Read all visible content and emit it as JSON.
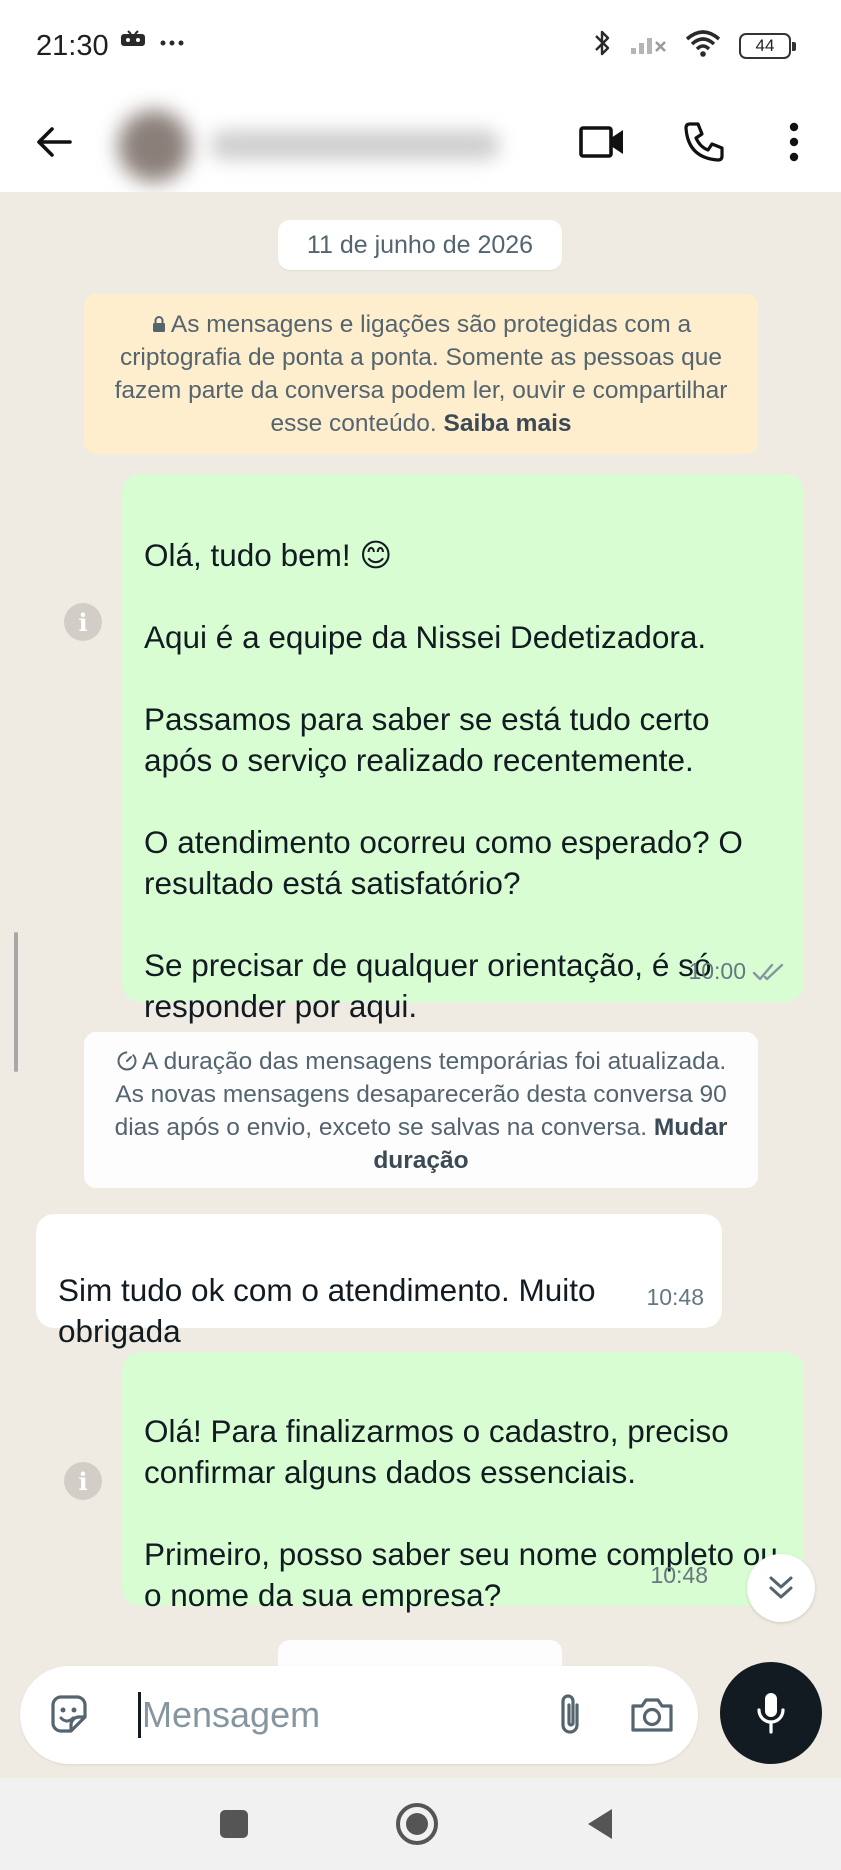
{
  "status_bar": {
    "time": "21:30",
    "notification_icons": [
      "game-controller-icon",
      "more-dots-icon"
    ],
    "system_icons": [
      "bluetooth-icon",
      "cellular-signal-icon",
      "wifi-icon"
    ],
    "battery_level": "44"
  },
  "header": {
    "back_icon": "arrow-left-icon",
    "contact_name_visible": false,
    "actions": [
      "video-call-icon",
      "voice-call-icon",
      "more-vert-icon"
    ]
  },
  "chat": {
    "date_chip": "11 de junho de 2026",
    "encryption_notice": {
      "text": "As mensagens e ligações são protegidas com a criptografia de ponta a ponta. Somente as pessoas que fazem parte da conversa podem ler, ouvir e compartilhar esse conteúdo.",
      "link": "Saiba mais"
    },
    "messages": [
      {
        "direction": "outgoing",
        "text": "Olá, tudo bem! 😊\n\nAqui é a equipe da Nissei Dedetizadora.\n\nPassamos para saber se está tudo certo após o serviço realizado recentemente.\n\nO atendimento ocorreu como esperado? O resultado está satisfatório?\n\nSe precisar de qualquer orientação, é só responder por aqui.",
        "time": "10:00",
        "status": "read"
      },
      {
        "direction": "incoming",
        "text": "Sim tudo ok com o atendimento.  Muito obrigada",
        "time": "10:48"
      },
      {
        "direction": "outgoing",
        "text": "Olá! Para finalizarmos o cadastro, preciso confirmar alguns dados essenciais.\n\nPrimeiro, posso saber seu nome completo ou o nome da sua empresa?",
        "time": "10:48"
      }
    ],
    "system_notice": {
      "text": "A duração das mensagens temporárias foi atualizada. As novas mensagens desaparecerão desta conversa 90 dias após o envio, exceto se salvas na conversa.",
      "link": "Mudar duração"
    }
  },
  "composer": {
    "placeholder": "Mensagem"
  },
  "colors": {
    "outgoing_bubble": "#d9fdd3",
    "incoming_bubble": "#ffffff",
    "chat_background": "#efeae2",
    "encryption_notice_bg": "#ffeecd",
    "read_ticks": "#53bdeb"
  }
}
